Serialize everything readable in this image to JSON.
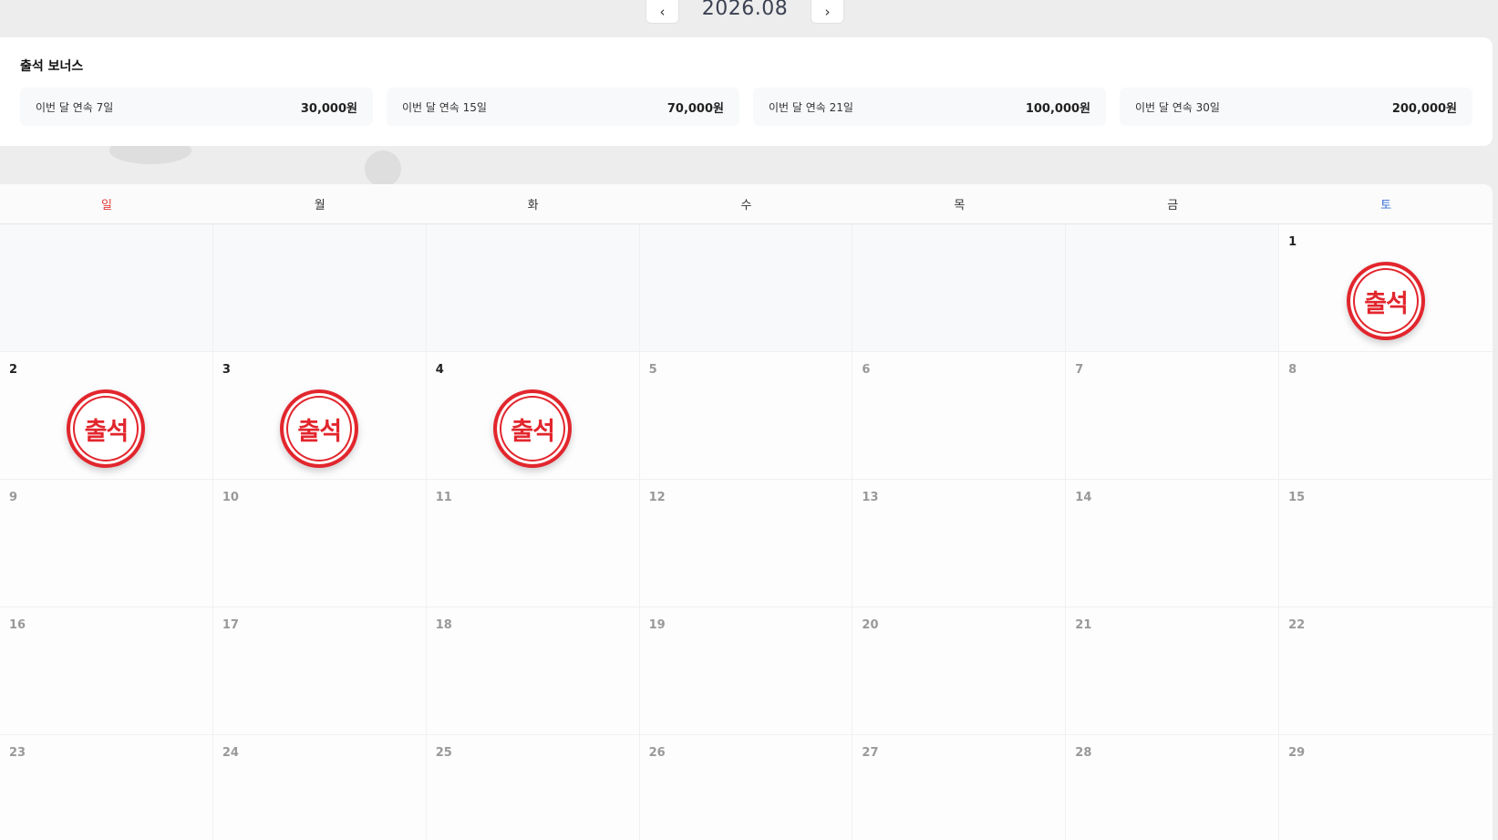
{
  "month_nav": {
    "prev_icon": "‹",
    "next_icon": "›",
    "month": "2026.08"
  },
  "bonus": {
    "title": "출석 보너스",
    "items": [
      {
        "label": "이번 달 연속 7일",
        "amount": "30,000원"
      },
      {
        "label": "이번 달 연속 15일",
        "amount": "70,000원"
      },
      {
        "label": "이번 달 연속 21일",
        "amount": "100,000원"
      },
      {
        "label": "이번 달 연속 30일",
        "amount": "200,000원"
      }
    ]
  },
  "calendar": {
    "weekdays": [
      "일",
      "월",
      "화",
      "수",
      "목",
      "금",
      "토"
    ],
    "stamp_label": "출석",
    "leading_blanks": 6,
    "days": [
      {
        "day": "1",
        "stamped": true
      },
      {
        "day": "2",
        "stamped": true
      },
      {
        "day": "3",
        "stamped": true
      },
      {
        "day": "4",
        "stamped": true
      },
      {
        "day": "5",
        "stamped": false
      },
      {
        "day": "6",
        "stamped": false
      },
      {
        "day": "7",
        "stamped": false
      },
      {
        "day": "8",
        "stamped": false
      },
      {
        "day": "9",
        "stamped": false
      },
      {
        "day": "10",
        "stamped": false
      },
      {
        "day": "11",
        "stamped": false
      },
      {
        "day": "12",
        "stamped": false
      },
      {
        "day": "13",
        "stamped": false
      },
      {
        "day": "14",
        "stamped": false
      },
      {
        "day": "15",
        "stamped": false
      },
      {
        "day": "16",
        "stamped": false
      },
      {
        "day": "17",
        "stamped": false
      },
      {
        "day": "18",
        "stamped": false
      },
      {
        "day": "19",
        "stamped": false
      },
      {
        "day": "20",
        "stamped": false
      },
      {
        "day": "21",
        "stamped": false
      },
      {
        "day": "22",
        "stamped": false
      },
      {
        "day": "23",
        "stamped": false
      },
      {
        "day": "24",
        "stamped": false
      },
      {
        "day": "25",
        "stamped": false
      },
      {
        "day": "26",
        "stamped": false
      },
      {
        "day": "27",
        "stamped": false
      },
      {
        "day": "28",
        "stamped": false
      },
      {
        "day": "29",
        "stamped": false
      }
    ]
  }
}
